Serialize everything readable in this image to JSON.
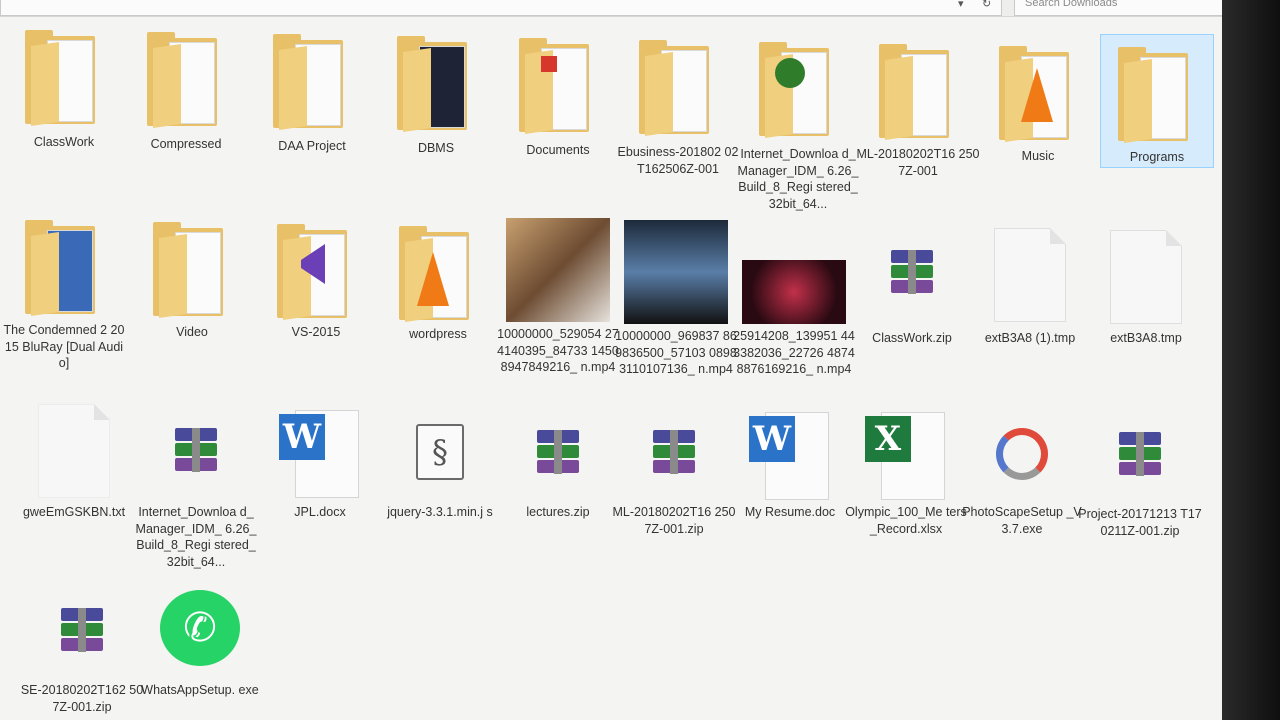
{
  "toolbar": {
    "search_placeholder": "Search Downloads"
  },
  "items": [
    {
      "id": "classwork",
      "label": "ClassWork"
    },
    {
      "id": "compressed",
      "label": "Compressed"
    },
    {
      "id": "daa-project",
      "label": "DAA Project"
    },
    {
      "id": "dbms",
      "label": "DBMS"
    },
    {
      "id": "documents",
      "label": "Documents"
    },
    {
      "id": "ebusiness",
      "label": "Ebusiness-201802 02T162506Z-001"
    },
    {
      "id": "idm-folder",
      "label": "Internet_Downloa d_Manager_IDM_ 6.26_Build_8_Regi stered_32bit_64..."
    },
    {
      "id": "ml-folder",
      "label": "ML-20180202T16 2507Z-001"
    },
    {
      "id": "music",
      "label": "Music"
    },
    {
      "id": "programs",
      "label": "Programs"
    },
    {
      "id": "condemned",
      "label": "The Condemned 2 2015 BluRay [Dual Audio]"
    },
    {
      "id": "video",
      "label": "Video"
    },
    {
      "id": "vs2015",
      "label": "VS-2015"
    },
    {
      "id": "wordpress",
      "label": "wordpress"
    },
    {
      "id": "mp4-1",
      "label": "10000000_529054 274140395_84733 14508947849216_ n.mp4"
    },
    {
      "id": "mp4-2",
      "label": "10000000_969837 869836500_57103 08983110107136_ n.mp4"
    },
    {
      "id": "mp4-3",
      "label": "25914208_139951 443382036_22726 48748876169216_ n.mp4"
    },
    {
      "id": "classwork-zip",
      "label": "ClassWork.zip"
    },
    {
      "id": "tmp1",
      "label": "extB3A8 (1).tmp"
    },
    {
      "id": "tmp2",
      "label": "extB3A8.tmp"
    },
    {
      "id": "txt",
      "label": "gweEmGSKBN.txt"
    },
    {
      "id": "idm-zip",
      "label": "Internet_Downloa d_Manager_IDM_ 6.26_Build_8_Regi stered_32bit_64..."
    },
    {
      "id": "jpl-docx",
      "label": "JPL.docx"
    },
    {
      "id": "jquery",
      "label": "jquery-3.3.1.min.j s"
    },
    {
      "id": "lectures",
      "label": "lectures.zip"
    },
    {
      "id": "ml-zip",
      "label": "ML-20180202T16 2507Z-001.zip"
    },
    {
      "id": "resume",
      "label": "My Resume.doc"
    },
    {
      "id": "olympic",
      "label": "Olympic_100_Me ters_Record.xlsx"
    },
    {
      "id": "photoscape",
      "label": "PhotoScapeSetup _V3.7.exe"
    },
    {
      "id": "project-zip",
      "label": "Project-20171213 T170211Z-001.zip"
    },
    {
      "id": "se-zip",
      "label": "SE-20180202T162 507Z-001.zip"
    },
    {
      "id": "whatsapp",
      "label": "WhatsAppSetup. exe"
    }
  ],
  "colors": {
    "folder": "#e8c067",
    "selection": "#cce8ff",
    "word": "#2b73c9",
    "excel": "#1f7a3d",
    "whatsapp": "#25d366",
    "vlc": "#f07a15"
  }
}
